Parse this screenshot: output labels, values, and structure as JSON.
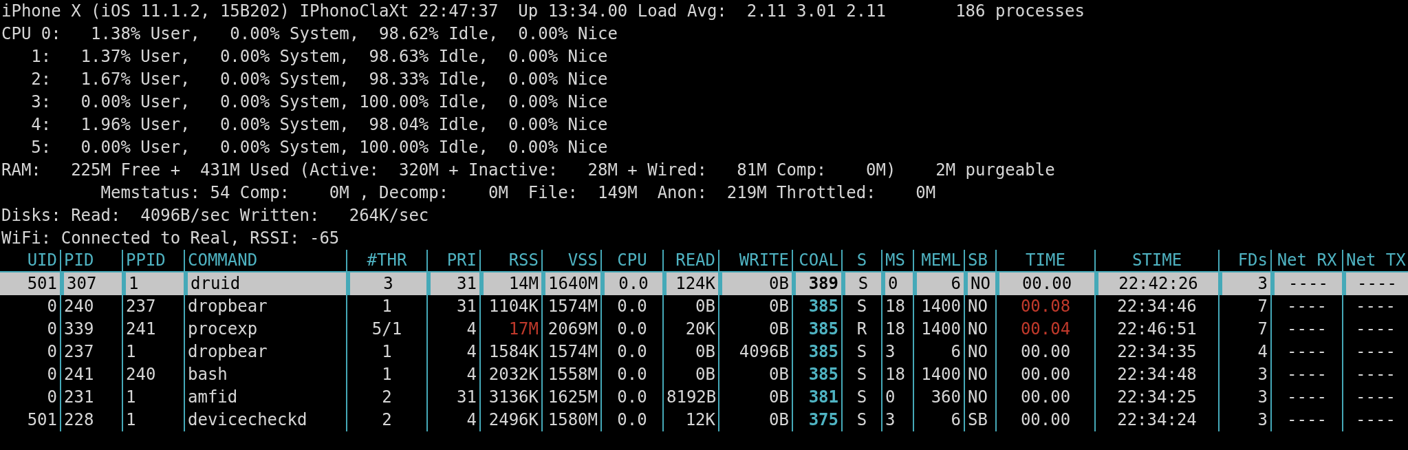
{
  "summary_lines": [
    "iPhone X (iOS 11.1.2, 15B202) IPhonoClaXt 22:47:37  Up 13:34.00 Load Avg:  2.11 3.01 2.11       186 processes",
    "CPU 0:   1.38% User,   0.00% System,  98.62% Idle,  0.00% Nice",
    "   1:   1.37% User,   0.00% System,  98.63% Idle,  0.00% Nice",
    "   2:   1.67% User,   0.00% System,  98.33% Idle,  0.00% Nice",
    "   3:   0.00% User,   0.00% System, 100.00% Idle,  0.00% Nice",
    "   4:   1.96% User,   0.00% System,  98.04% Idle,  0.00% Nice",
    "   5:   0.00% User,   0.00% System, 100.00% Idle,  0.00% Nice",
    "RAM:   225M Free +  431M Used (Active:  320M + Inactive:   28M + Wired:   81M Comp:    0M)    2M purgeable",
    "          Memstatus: 54 Comp:    0M , Decomp:    0M  File:  149M  Anon:  219M Throttled:    0M",
    "Disks: Read:  4096B/sec Written:   264K/sec",
    "WiFi: Connected to Real, RSSI: -65"
  ],
  "table": {
    "columns": [
      "UID",
      "PID",
      "PPID",
      "COMMAND",
      "#THR",
      "PRI",
      "RSS",
      "VSS",
      "CPU",
      "READ",
      "WRITE",
      "COAL",
      "S",
      "MS",
      "MEML",
      "SB",
      "TIME",
      "STIME",
      "FDs",
      "Net RX",
      "Net TX"
    ],
    "rows": [
      {
        "selected": true,
        "rss_alert": false,
        "time_alert": false,
        "cells": [
          "501",
          "307",
          "1",
          "druid",
          "3",
          "31",
          "14M",
          "1640M",
          "0.0",
          "124K",
          "0B",
          "389",
          "S",
          "0",
          "6",
          "NO",
          "00.00",
          "22:42:26",
          "3",
          "----",
          "----"
        ]
      },
      {
        "selected": false,
        "rss_alert": false,
        "time_alert": true,
        "cells": [
          "0",
          "240",
          "237",
          "dropbear",
          "1",
          "31",
          "1104K",
          "1574M",
          "0.0",
          "0B",
          "0B",
          "385",
          "S",
          "18",
          "1400",
          "NO",
          "00.08",
          "22:34:46",
          "7",
          "----",
          "----"
        ]
      },
      {
        "selected": false,
        "rss_alert": true,
        "time_alert": true,
        "cells": [
          "0",
          "339",
          "241",
          "procexp",
          "5/1",
          "4",
          "17M",
          "2069M",
          "0.0",
          "20K",
          "0B",
          "385",
          "R",
          "18",
          "1400",
          "NO",
          "00.04",
          "22:46:51",
          "7",
          "----",
          "----"
        ]
      },
      {
        "selected": false,
        "rss_alert": false,
        "time_alert": false,
        "cells": [
          "0",
          "237",
          "1",
          "dropbear",
          "1",
          "4",
          "1584K",
          "1574M",
          "0.0",
          "0B",
          "4096B",
          "385",
          "S",
          "3",
          "6",
          "NO",
          "00.00",
          "22:34:35",
          "4",
          "----",
          "----"
        ]
      },
      {
        "selected": false,
        "rss_alert": false,
        "time_alert": false,
        "cells": [
          "0",
          "241",
          "240",
          "bash",
          "1",
          "4",
          "2032K",
          "1558M",
          "0.0",
          "0B",
          "0B",
          "385",
          "S",
          "18",
          "1400",
          "NO",
          "00.00",
          "22:34:48",
          "3",
          "----",
          "----"
        ]
      },
      {
        "selected": false,
        "rss_alert": false,
        "time_alert": false,
        "cells": [
          "0",
          "231",
          "1",
          "amfid",
          "2",
          "31",
          "3136K",
          "1625M",
          "0.0",
          "8192B",
          "0B",
          "381",
          "S",
          "0",
          "360",
          "NO",
          "00.00",
          "22:34:25",
          "3",
          "----",
          "----"
        ]
      },
      {
        "selected": false,
        "rss_alert": false,
        "time_alert": false,
        "cells": [
          "501",
          "228",
          "1",
          "devicecheckd",
          "2",
          "4",
          "2496K",
          "1580M",
          "0.0",
          "12K",
          "0B",
          "375",
          "S",
          "3",
          "6",
          "SB",
          "00.00",
          "22:34:24",
          "3",
          "----",
          "----"
        ]
      }
    ]
  }
}
